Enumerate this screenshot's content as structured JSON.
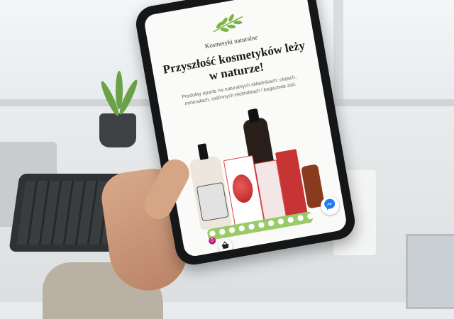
{
  "page": {
    "brand_label": "Kosmetyki naturalne",
    "headline": "Przyszłość kosmetyków leży w naturze!",
    "subtext": "Produkty oparte na naturalnych składnikach: olejach, minerałach, roślinnych ekstraktach i bogactwie ziół.",
    "logo_icon": "leaf-branch-icon",
    "accent_color": "#7cb342"
  },
  "widgets": {
    "cart_icon": "basket-icon",
    "cart_count": "0",
    "chat_icon": "messenger-icon",
    "chat_color": "#1e7cf2"
  }
}
